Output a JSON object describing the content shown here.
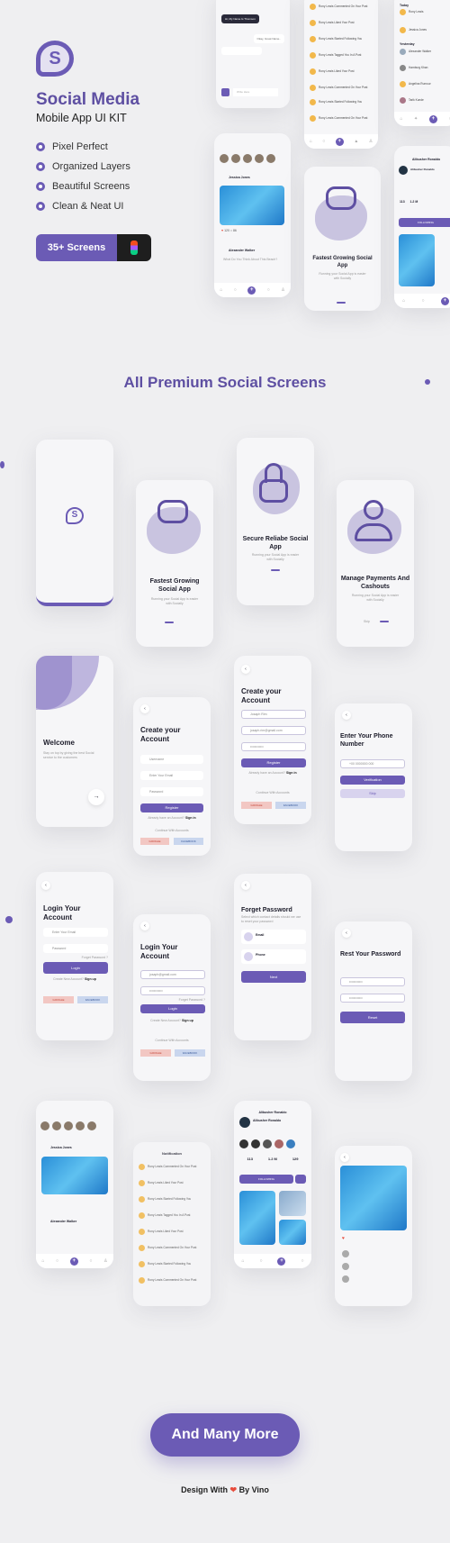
{
  "hero": {
    "logo_letter": "S",
    "title": "Social Media",
    "subtitle": "Mobile App UI KIT",
    "features": [
      "Pixel Perfect",
      "Organized Layers",
      "Beautiful Screens",
      "Clean & Neat UI"
    ],
    "badge": "35+ Screens"
  },
  "preview": {
    "chat": {
      "bubble_dark": "Hi, My Name Is Thomson",
      "bubble_light": "Okay, Great Name..",
      "input_placeholder": "Write Here"
    },
    "notifications": {
      "items": [
        "Rony Lewis Commented On Your Post",
        "Rony Lewis Liked Your Post",
        "Rony Lewis Started Following You",
        "Rony Lewis Tagged You In A Post",
        "Rony Lewis Liked Your Post",
        "Rony Lewis Commented On Your Post",
        "Rony Lewis Started Following You",
        "Rony Lewis Commented On Your Post"
      ]
    },
    "activity": {
      "today": "Today",
      "yesterday": "Yesterday",
      "items": [
        "Rony Lewis",
        "Jessica Jones",
        "Alexander Walker",
        "Hamburg Khan",
        "Angelina Rumour",
        "Tarik Kunde"
      ]
    },
    "feed": {
      "stories": [
        "You",
        "Jessica",
        "Lucia",
        "Jenifer",
        "Thomas"
      ],
      "post_author": "Jessica Jones",
      "second_author": "Alexander Walker",
      "second_text": "What Do You Think About This Beach?",
      "likes": "120",
      "comments": "86"
    },
    "onboarding": {
      "title": "Fastest Growing Social App",
      "desc": "Running your Social App is easier with Socially"
    },
    "profile": {
      "header": "Alibusher Ronaldo",
      "name": "Alibusher Ronaldo",
      "stats": [
        "113",
        "1.2 M"
      ],
      "button": "FOLLOWING"
    }
  },
  "section_title": "All Premium Social Screens",
  "screens": {
    "splash": {
      "logo_letter": "S"
    },
    "onb1": {
      "title": "Fastest Growing Social App",
      "desc": "Running your Social App is easier with Socially"
    },
    "onb2": {
      "title": "Secure Reliabe Social App",
      "desc": "Running your Social App is easier with Socially"
    },
    "onb3": {
      "title": "Manage Payments And Cashouts",
      "desc": "Running your Social App is easier with Socially",
      "skip": "Skip"
    },
    "welcome": {
      "title": "Welcome",
      "desc": "Stay on top by giving the best Social service to the customers",
      "arrow": "→"
    },
    "create": {
      "title": "Create your Account",
      "fields": [
        "Username",
        "Enter Your Email",
        "Password"
      ],
      "button": "Register",
      "already": "Already have an Account?",
      "signin": "Sign in",
      "continue": "Continue With Accounts",
      "google": "GOOGLE",
      "facebook": "FACEBOOK"
    },
    "create2": {
      "title": "Create your Account",
      "fields": [
        "Josaph Rim",
        "josaph.rim@gmail.com",
        "••••••••••••"
      ],
      "button": "Register",
      "already": "Already have an Account?",
      "signin": "Sign in",
      "continue": "Continue With Accounts",
      "google": "GOOGLE",
      "facebook": "FACEBOOK"
    },
    "phone": {
      "title": "Enter Your Phone Number",
      "field": "+00 0000000 000",
      "button": "Verification",
      "skip": "Skip"
    },
    "login": {
      "title": "Login Your Account",
      "fields": [
        "Enter Your Email",
        "Password"
      ],
      "forgot": "Forget Password ?",
      "button": "Login",
      "noaccount": "Create New Account?",
      "signup": "Sign up",
      "google": "GOOGLE",
      "facebook": "FACEBOOK"
    },
    "login2": {
      "title": "Login Your Account",
      "fields": [
        "josaph@gmail.com",
        "••••••••••••"
      ],
      "forgot": "Forget Password ?",
      "button": "Login",
      "noaccount": "Create New Account?",
      "signup": "Sign up",
      "continue": "Continue With Accounts",
      "google": "GOOGLE",
      "facebook": "FACEBOOK"
    },
    "forget": {
      "title": "Forget Password",
      "desc": "Select which contact details should we use to reset your password",
      "email": "Email",
      "phone": "Phone",
      "button": "Next"
    },
    "reset": {
      "title": "Rest Your Password",
      "fields": [
        "••••••••••••",
        "••••••••••••"
      ],
      "button": "Reset"
    },
    "feed": {
      "stories": [
        "You",
        "Jessica",
        "Lucia",
        "Jenifer",
        "Thomas"
      ],
      "post_author": "Jessica Jones",
      "second_author": "Alexander Walker"
    },
    "notification": {
      "header": "Notification",
      "items": [
        "Rony Lewis Commented On Your Post",
        "Rony Lewis Liked Your Post",
        "Rony Lewis Started Following You",
        "Rony Lewis Tagged You In A Post",
        "Rony Lewis Liked Your Post",
        "Rony Lewis Commented On Your Post",
        "Rony Lewis Started Following You",
        "Rony Lewis Commented On Your Post"
      ]
    },
    "profile": {
      "header": "Alibusher Ronaldo",
      "name": "Alibusher Ronaldo",
      "stats": [
        "113",
        "1.2 M",
        "129"
      ],
      "button": "FOLLOWING"
    }
  },
  "cta": "And Many More",
  "footer": {
    "prefix": "Design With",
    "suffix": "By Vino",
    "heart": "❤"
  },
  "colors": {
    "accent": "#6b5bb5",
    "background": "#efeff1",
    "heart": "#e74c3c"
  }
}
